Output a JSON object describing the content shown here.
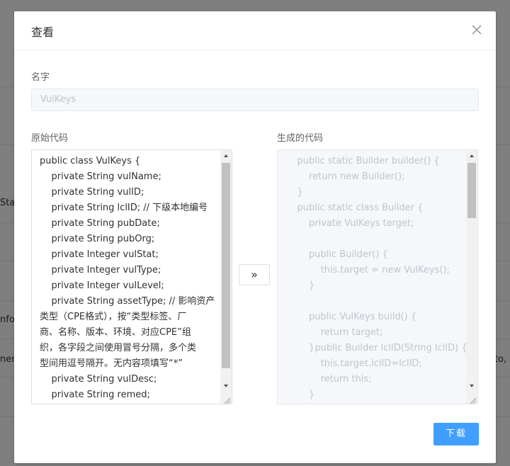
{
  "background": {
    "fragments": [
      "Stat",
      "nfo",
      "nen",
      "oto,"
    ]
  },
  "dialog": {
    "title": "查看",
    "close_icon": "close-icon"
  },
  "name_field": {
    "label": "名字",
    "value": "VulKeys"
  },
  "original_code": {
    "label": "原始代码",
    "lines": [
      "public class VulKeys {",
      "    private String vulName;",
      "    private String vulID;",
      "    private String lclID; // 下级本地编号",
      "    private String pubDate;",
      "    private String pubOrg;",
      "    private Integer vulStat;",
      "    private Integer vulType;",
      "    private Integer vulLevel;",
      "    private String assetType; // 影响资产",
      "类型（CPE格式），按“类型标签、厂",
      "商、名称、版本、环境、对应CPE”组",
      "织，各字段之间使用冒号分隔，多个类",
      "型间用逗号隔开。无内容项填写“*”",
      "    private String vulDesc;",
      "    private String remed;"
    ]
  },
  "generated_code": {
    "label": "生成的代码",
    "lines": [
      "    public static Builder builder() {",
      "        return new Builder();",
      "    }",
      "    public static class Builder {",
      "        private VulKeys target;",
      "",
      "        public Builder() {",
      "            this.target = new VulKeys();",
      "        }",
      "",
      "        public VulKeys build() {",
      "            return target;",
      "        }public Builder lclID(String lclID) {",
      "            this.target.lclID=lclID;",
      "            return this;",
      "        }"
    ]
  },
  "convert_button": {
    "label": "»"
  },
  "download_button": {
    "label": "下载"
  },
  "colors": {
    "primary": "#409eff",
    "mask": "rgba(0,0,0,0.5)"
  }
}
